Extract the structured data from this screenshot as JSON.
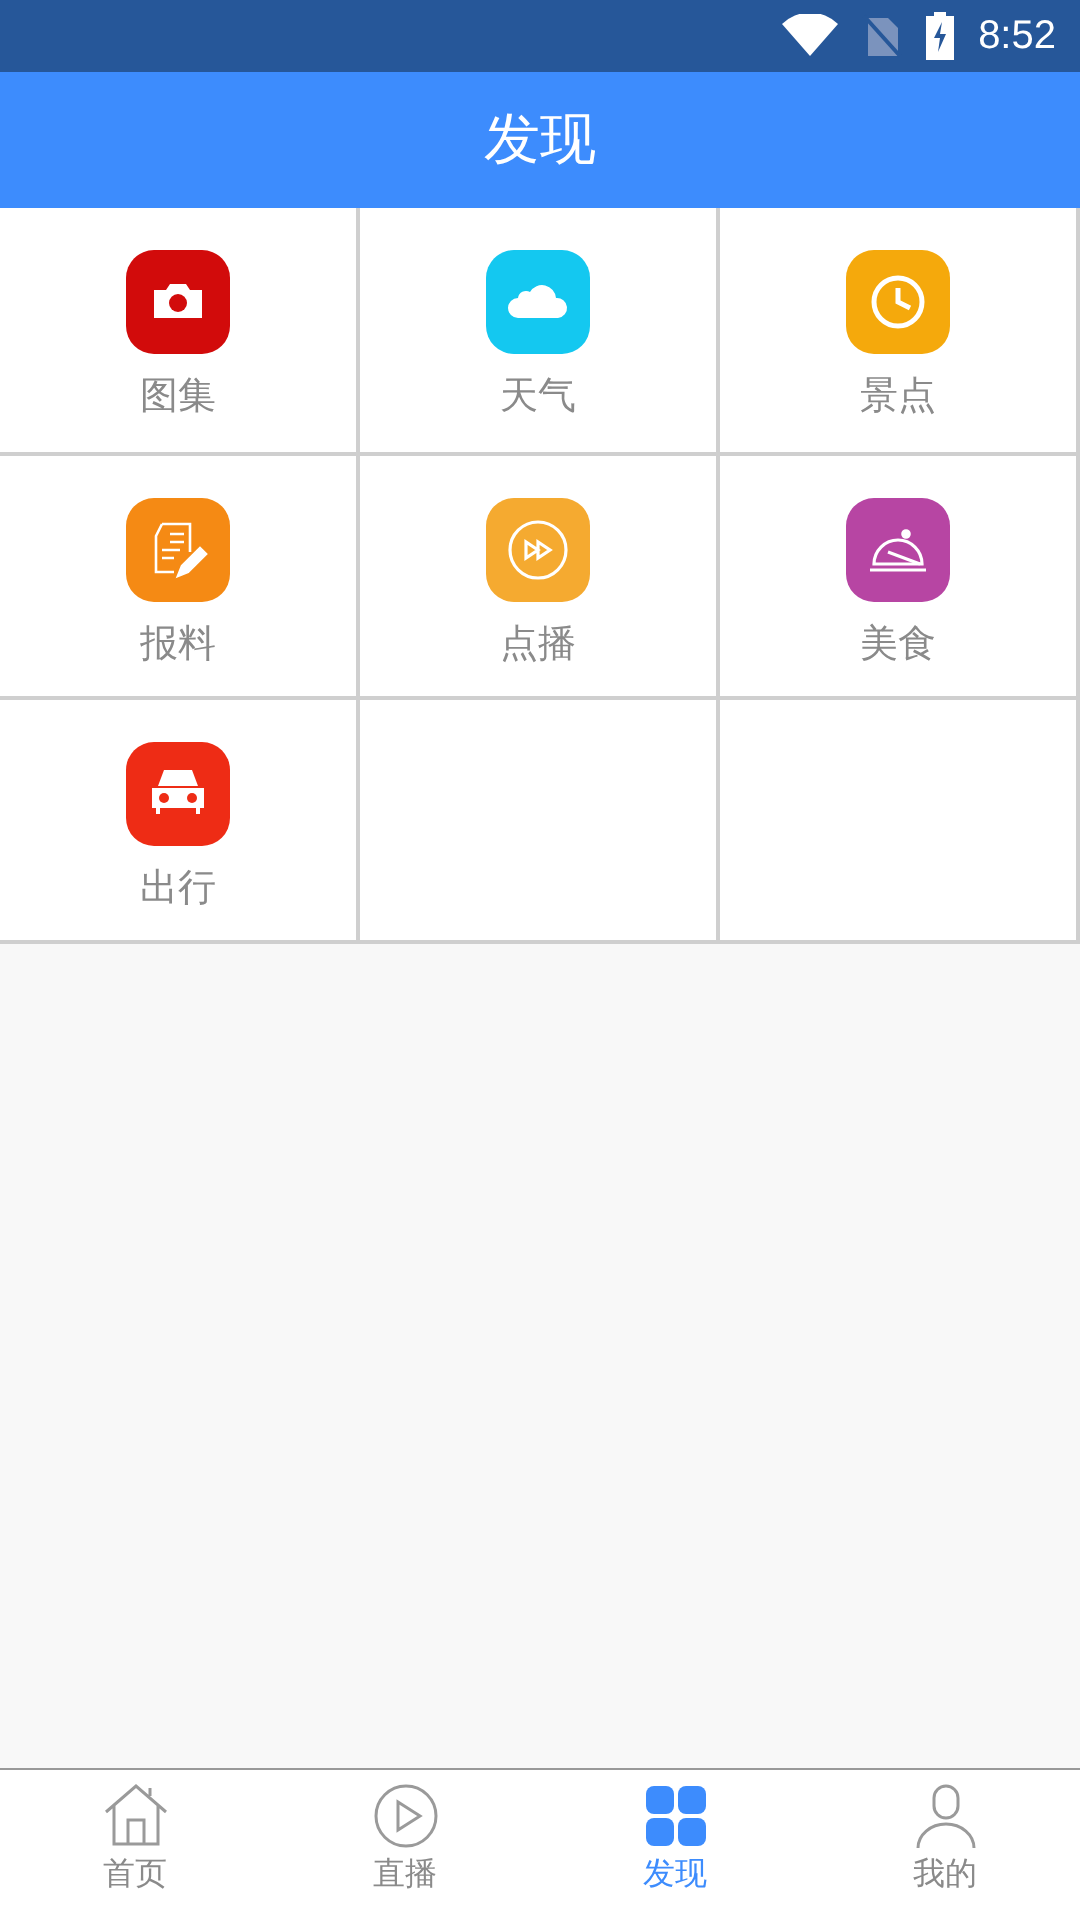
{
  "status_bar": {
    "time": "8:52"
  },
  "header": {
    "title": "发现"
  },
  "grid": [
    {
      "label": "图集",
      "kind": "camera",
      "color": "#d20b0b"
    },
    {
      "label": "天气",
      "kind": "cloud",
      "color": "#14c8f0"
    },
    {
      "label": "景点",
      "kind": "clock",
      "color": "#f5a90c"
    },
    {
      "label": "报料",
      "kind": "note",
      "color": "#f58a14"
    },
    {
      "label": "点播",
      "kind": "play",
      "color": "#f5aa30"
    },
    {
      "label": "美食",
      "kind": "dish",
      "color": "#b745a3"
    },
    {
      "label": "出行",
      "kind": "car",
      "color": "#ee2c15"
    }
  ],
  "bottom_nav": [
    {
      "label": "首页",
      "kind": "home",
      "selected": false
    },
    {
      "label": "直播",
      "kind": "live",
      "selected": false
    },
    {
      "label": "发现",
      "kind": "discover",
      "selected": true
    },
    {
      "label": "我的",
      "kind": "user",
      "selected": false
    }
  ]
}
